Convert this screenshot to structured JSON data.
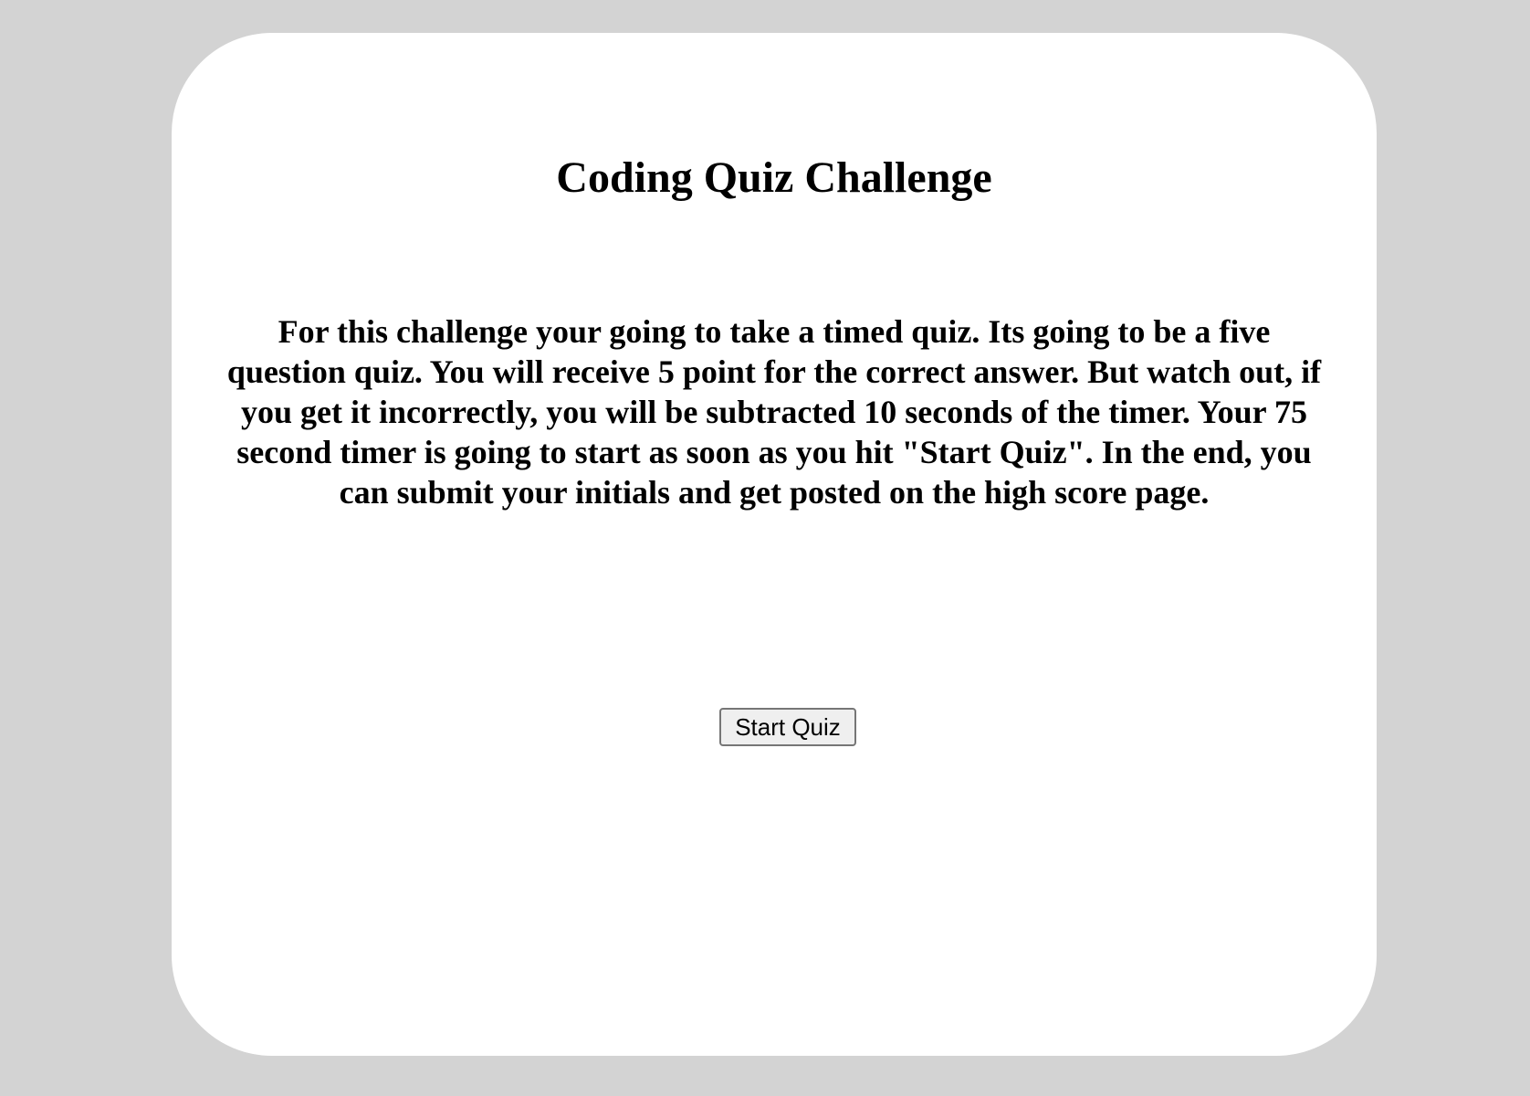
{
  "page": {
    "title": "Coding Quiz Challenge",
    "instructions": "For this challenge your going to take a timed quiz. Its going to be a five question quiz. You will receive 5 point for the correct answer. But watch out, if you get it incorrectly, you will be subtracted 10 seconds of the timer. Your 75 second timer is going to start as soon as you hit \"Start Quiz\". In the end, you can submit your initials and get posted on the high score page.",
    "start_button_label": "Start Quiz"
  },
  "colors": {
    "background": "#d3d3d3",
    "card": "#ffffff",
    "text": "#000000",
    "button_bg": "#efefef",
    "button_border": "#767676"
  }
}
